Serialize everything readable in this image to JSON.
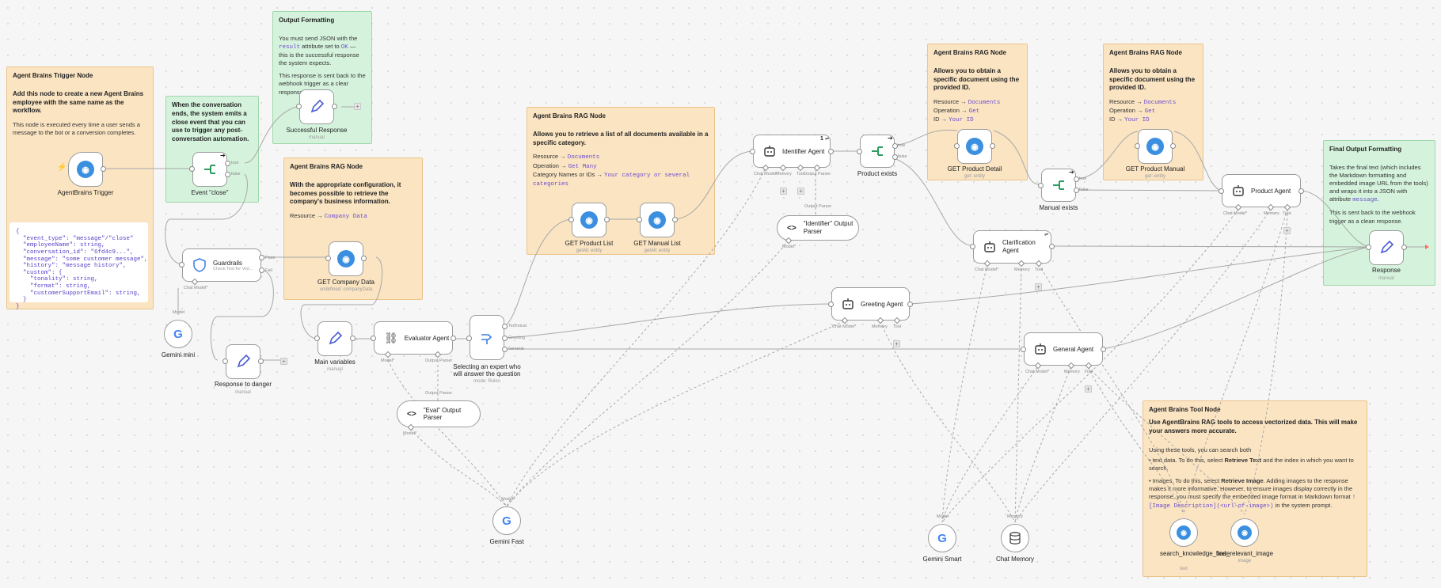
{
  "colors": {
    "accent": "#ff6d5a",
    "sticky_orange": "#fae4c2",
    "sticky_green": "#d5f3dc",
    "code": "#6b4ccf"
  },
  "stickies": {
    "trigger": {
      "title": "Agent Brains Trigger Node",
      "strong": "Add this node to create a new Agent Brains employee with the same name as the workflow.",
      "body": "This node is executed every time a user sends a message to the bot or a conversion completes."
    },
    "close": {
      "strong": "When the conversation ends, the system emits a close event that you can use to trigger any post-conversation automation."
    },
    "output": {
      "title": "Output Formatting",
      "p1a": "You must send JSON with the ",
      "p1code": "result",
      "p1b": " attribute set to ",
      "p1code2": "OK",
      "p1c": " — this is the successful response the system expects.",
      "p2": "This response is sent back to the webhook trigger as a clear response."
    },
    "company": {
      "title": "Agent Brains RAG Node",
      "strong": "With the appropriate configuration, it becomes possible to retrieve the company's business information.",
      "resource_label": "Resource → ",
      "resource_value": "Company Data"
    },
    "list": {
      "title": "Agent Brains RAG Node",
      "strong": "Allows you to retrieve a list of all documents available in a specific category.",
      "l1a": "Resource → ",
      "l1b": "Documents",
      "l2a": "Operation → ",
      "l2b": "Get Many",
      "l3a": "Category Names or IDs → ",
      "l3b": "Your category or several categories"
    },
    "detail": {
      "title": "Agent Brains RAG Node",
      "strong": "Allows you to obtain a specific document using the provided ID.",
      "l1a": "Resource → ",
      "l1b": "Documents",
      "l2a": "Operation → ",
      "l2b": "Get",
      "l3a": "ID → ",
      "l3b": "Your ID"
    },
    "manual": {
      "title": "Agent Brains RAG Node",
      "strong": "Allows you to obtain a specific document using the provided ID.",
      "l1a": "Resource → ",
      "l1b": "Documents",
      "l2a": "Operation → ",
      "l2b": "Get",
      "l3a": "ID → ",
      "l3b": "Your ID"
    },
    "final": {
      "title": "Final Output Formatting",
      "p1a": "Takes the final text (which includes the Markdown formatting and embedded image URL from the tools) and wraps it into a JSON with attribute ",
      "p1code": "message",
      "p1b": ".",
      "p2": "This is sent back to the webhook trigger as a clean response."
    },
    "tool": {
      "title": "Agent Brains Tool Node",
      "strong": "Use AgentBrains RAG tools to access vectorized data. This will make your answers more accurate.",
      "intro": "Using these tools, you can search both",
      "b1a": "text data. To do this, select ",
      "b1b": "Retrieve Text",
      "b1c": " and the index in which you want to search.",
      "b2a": "Images. To do this, select ",
      "b2b": "Retrieve Image",
      "b2c": ". Adding images to the response makes it more informative. However, to ensure images display correctly in the response, you must specify the embedded image format in Markdown format ",
      "b2code": "![Image Description](<url-of-image>)",
      "b2d": " in the system prompt."
    }
  },
  "code_sample": "{\n  \"event_type\": \"message\"/\"close\"\n  \"employeeName\": string,\n  \"conversation_id\": \"6fd4c9...\",\n  \"message\": \"some customer message\",\n  \"history\": \"message history\",\n  \"custom\": {\n    \"tonality\": string,\n    \"format\": string,\n    \"customerSupportEmail\": string,\n  }\n}",
  "nodes": {
    "trigger": {
      "label": "AgentBrains Trigger",
      "icon": "brain-icon"
    },
    "close_event": {
      "label": "Event \"close\"",
      "true": "true",
      "false": "false"
    },
    "success": {
      "label": "Successful Response",
      "sub": "manual"
    },
    "guardrails": {
      "label": "Guardrails",
      "sub": "Check Text for Viol...",
      "pass": "Pass",
      "fail": "Fail",
      "chat_model": "Chat Model*"
    },
    "gemini_mini": {
      "label": "Gemini mini",
      "model": "Model"
    },
    "danger": {
      "label": "Response to danger",
      "sub": "manual"
    },
    "company": {
      "label": "GET Company Data",
      "sub": "undefined: companyData"
    },
    "main_vars": {
      "label": "Main variables",
      "sub": "manual"
    },
    "evaluator": {
      "label": "Evaluator Agent",
      "model": "Model*",
      "parser": "Output Parser"
    },
    "eval_parser": {
      "label": "\"Eval\" Output Parser",
      "parser": "Output Parser",
      "model": "Model*"
    },
    "switch": {
      "label": "Selecting an expert who will answer the question",
      "sub": "mode: Rules",
      "o1": "Technical",
      "o2": "Greeting",
      "o3": "General"
    },
    "list": {
      "label": "GET Product List",
      "sub": "getAll: entity"
    },
    "manual_list": {
      "label": "GET Manual List",
      "sub": "getAll: entity"
    },
    "identifier": {
      "label": "Identifier Agent",
      "chat_model": "Chat Model*",
      "memory": "Memory",
      "tool": "Tool",
      "parser": "Output Parser",
      "badge": "1"
    },
    "id_parser": {
      "label": "\"Identifier\" Output Parser",
      "parser": "Output Parser",
      "model": "Model*"
    },
    "product_exists": {
      "label": "Product exists",
      "true": "true",
      "false": "false"
    },
    "detail": {
      "label": "GET Product Detail",
      "sub": "get: entity"
    },
    "manual_exists": {
      "label": "Manual exists",
      "true": "true",
      "false": "false"
    },
    "product_manual": {
      "label": "GET Product Manual",
      "sub": "get: entity"
    },
    "product_agent": {
      "label": "Product Agent",
      "chat_model": "Chat Model*",
      "memory": "Memory",
      "tool": "Tool"
    },
    "response": {
      "label": "Response",
      "sub": "manual"
    },
    "clarify": {
      "label": "Clarification Agent",
      "chat_model": "Chat Model*",
      "memory": "Memory",
      "tool": "Tool"
    },
    "greeting": {
      "label": "Greeting Agent",
      "chat_model": "Chat Model*",
      "memory": "Memory",
      "tool": "Tool"
    },
    "general": {
      "label": "General Agent",
      "chat_model": "Chat Model*",
      "memory": "Memory",
      "tool": "Tool"
    },
    "gemini_fast": {
      "label": "Gemini Fast",
      "model": "Model"
    },
    "gemini_smart": {
      "label": "Gemini Smart",
      "model": "Model"
    },
    "chat_memory": {
      "label": "Chat Memory",
      "memory": "Memory"
    },
    "search_kb": {
      "label": "search_knowledge_base",
      "sub": "text"
    },
    "find_image": {
      "label": "find_relevant_image",
      "sub": "image"
    }
  }
}
